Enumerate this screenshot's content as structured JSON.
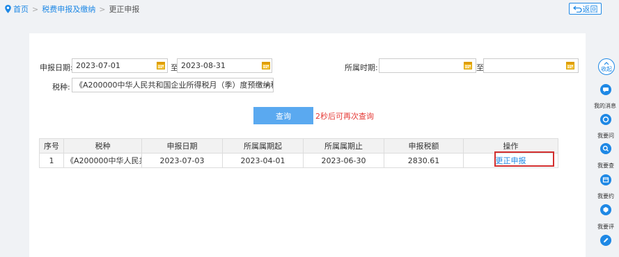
{
  "breadcrumb": {
    "home": "首页",
    "level1": "税费申报及缴纳",
    "current": "更正申报",
    "separator": ">"
  },
  "back_button": "返回",
  "filters": {
    "report_date_label": "申报日期:",
    "report_date_from": "2023-07-01",
    "to_label": "至",
    "report_date_to": "2023-08-31",
    "period_label": "所属时期:",
    "period_from": "",
    "period_to": "",
    "tax_type_label": "税种:",
    "tax_type_value": "《A200000中华人民共和国企业所得税月（季）度预缴纳税申报"
  },
  "query_button": "查询",
  "retry_hint": "2秒后可再次查询",
  "table": {
    "headers": [
      "序号",
      "税种",
      "申报日期",
      "所属属期起",
      "所属属期止",
      "申报税额",
      "操作"
    ],
    "rows": [
      [
        "1",
        "《A200000中华人民共...",
        "2023-07-03",
        "2023-04-01",
        "2023-06-30",
        "2830.61",
        "更正申报"
      ]
    ]
  },
  "sidebar": {
    "collapse_label": "收起",
    "items": [
      "我的消息",
      "我要问",
      "我要查",
      "我要约",
      "我要评"
    ]
  },
  "colors": {
    "accent": "#1e88e5",
    "query_button": "#5aa9f0",
    "alert": "#e53935",
    "highlight_box": "#d32f2f"
  }
}
